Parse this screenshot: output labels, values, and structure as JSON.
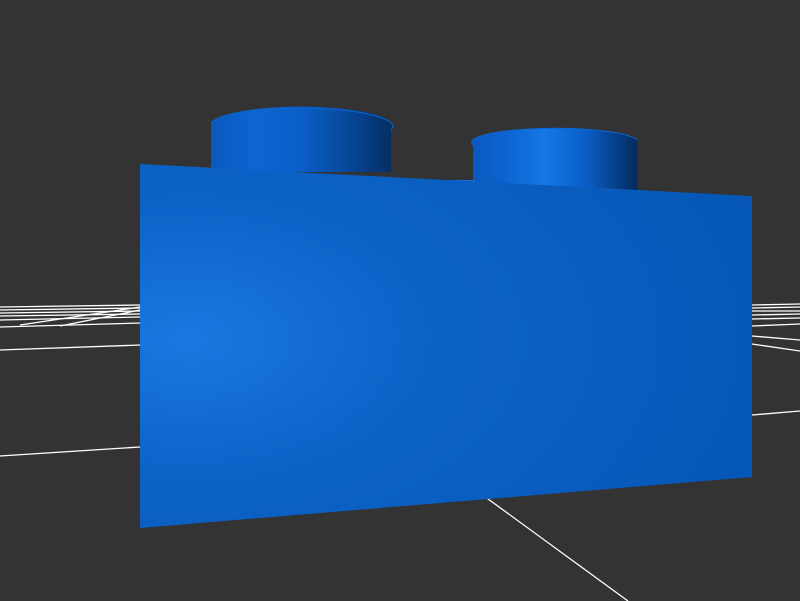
{
  "viewport": {
    "background_color": "#333333",
    "grid_color": "#ffffff"
  },
  "brick": {
    "color": "#0a5fc4",
    "highlight_color": "#1a78e0",
    "shadow_color": "#0b3a80",
    "stud_count": 2
  }
}
